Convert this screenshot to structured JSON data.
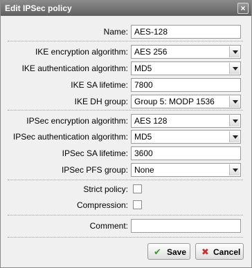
{
  "dialog": {
    "title": "Edit IPSec policy",
    "close_glyph": "×"
  },
  "fields": {
    "name": {
      "label": "Name:",
      "value": "AES-128"
    },
    "ike_enc": {
      "label": "IKE encryption algorithm:",
      "value": "AES 256"
    },
    "ike_auth": {
      "label": "IKE authentication algorithm:",
      "value": "MD5"
    },
    "ike_lifetime": {
      "label": "IKE SA lifetime:",
      "value": "7800"
    },
    "ike_dh": {
      "label": "IKE DH group:",
      "value": "Group 5: MODP 1536"
    },
    "ipsec_enc": {
      "label": "IPSec encryption algorithm:",
      "value": "AES 128"
    },
    "ipsec_auth": {
      "label": "IPSec authentication algorithm:",
      "value": "MD5"
    },
    "ipsec_lifetime": {
      "label": "IPSec SA lifetime:",
      "value": "3600"
    },
    "ipsec_pfs": {
      "label": "IPSec PFS group:",
      "value": "None"
    },
    "strict": {
      "label": "Strict policy:",
      "checked": false
    },
    "compression": {
      "label": "Compression:",
      "checked": false
    },
    "comment": {
      "label": "Comment:",
      "value": ""
    }
  },
  "buttons": {
    "save": {
      "label": "Save",
      "icon": "checkmark-icon",
      "icon_glyph": "✔",
      "color": "#3a9a2a"
    },
    "cancel": {
      "label": "Cancel",
      "icon": "close-icon",
      "icon_glyph": "✖",
      "color": "#c8302a"
    }
  }
}
